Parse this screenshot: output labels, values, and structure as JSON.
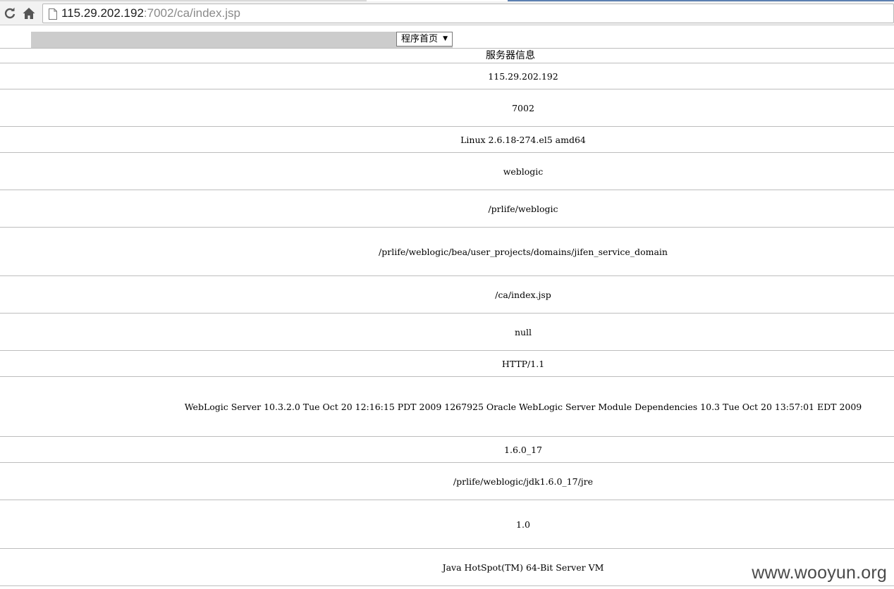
{
  "browser": {
    "url_host": "115.29.202.192",
    "url_rest": ":7002/ca/index.jsp",
    "icons": [
      "reload-icon",
      "home-icon",
      "page-icon"
    ]
  },
  "menu": {
    "selected": "程序首页"
  },
  "table": {
    "header": "服务器信息",
    "rows": [
      "115.29.202.192",
      "7002",
      "Linux 2.6.18-274.el5 amd64",
      "weblogic",
      "/prlife/weblogic",
      "/prlife/weblogic/bea/user_projects/domains/jifen_service_domain",
      "/ca/index.jsp",
      "null",
      "HTTP/1.1",
      "WebLogic Server 10.3.2.0 Tue Oct 20 12:16:15 PDT 2009 1267925 Oracle WebLogic Server Module Dependencies 10.3 Tue Oct 20 13:57:01 EDT 2009",
      "1.6.0_17",
      "/prlife/weblogic/jdk1.6.0_17/jre",
      "1.0",
      "Java HotSpot(TM) 64-Bit Server VM"
    ]
  },
  "watermark": "www.wooyun.org"
}
